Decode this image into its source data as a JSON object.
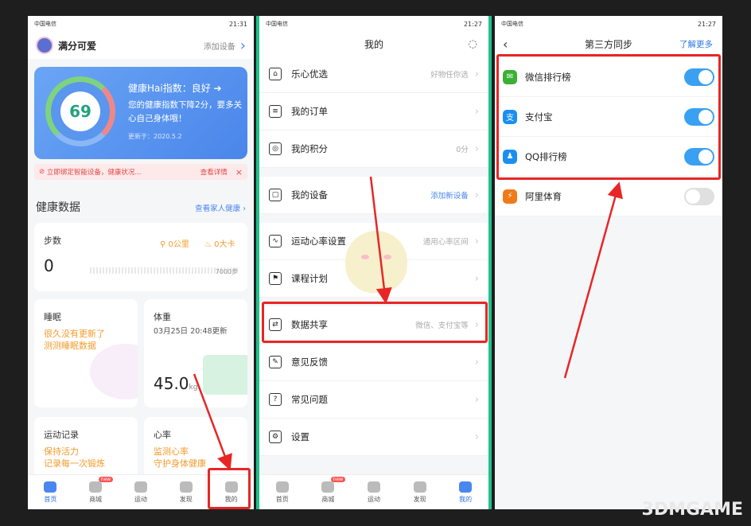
{
  "status": {
    "time1": "21:31",
    "time2": "21:27",
    "time3": "21:27",
    "carrier": "中国电信"
  },
  "p1": {
    "username": "满分可爱",
    "add_device": "添加设备",
    "health_title": "健康Hai指数：良好",
    "health_desc": "您的健康指数下降2分，要多关心自己身体哦！",
    "updated": "更新于：2020.5.2",
    "score": "69",
    "alert": "立即绑定智能设备，健康状况...",
    "alert_link": "查看详情",
    "section": "健康数据",
    "family": "查看家人健康",
    "steps_title": "步数",
    "steps_value": "0",
    "km": "0公里",
    "kcal": "0大卡",
    "target": "7000步",
    "sleep_title": "睡眠",
    "sleep_text1": "很久没有更新了",
    "sleep_text2": "测测睡眠数据",
    "weight_title": "体重",
    "weight_date": "03月25日 20:48更新",
    "weight_value": "45.0",
    "weight_unit": "kg",
    "sport_title": "运动记录",
    "sport_text1": "保持活力",
    "sport_text2": "记录每一次锻炼",
    "heart_title": "心率",
    "heart_text1": "监测心率",
    "heart_text2": "守护身体健康"
  },
  "tabs": [
    {
      "label": "首页"
    },
    {
      "label": "商城",
      "badge": "new"
    },
    {
      "label": "运动"
    },
    {
      "label": "发现"
    },
    {
      "label": "我的"
    }
  ],
  "p2": {
    "title": "我的",
    "items": [
      {
        "label": "乐心优选",
        "sub": "好物任你选"
      },
      {
        "label": "我的订单",
        "sub": ""
      },
      {
        "label": "我的积分",
        "sub": "0分"
      },
      {
        "label": "我的设备",
        "sub": "添加新设备"
      },
      {
        "label": "运动心率设置",
        "sub": "通用心率区间"
      },
      {
        "label": "课程计划",
        "sub": ""
      },
      {
        "label": "数据共享",
        "sub": "微信、支付宝等"
      },
      {
        "label": "意见反馈",
        "sub": ""
      },
      {
        "label": "常见问题",
        "sub": ""
      },
      {
        "label": "设置",
        "sub": ""
      }
    ]
  },
  "p3": {
    "title": "第三方同步",
    "more": "了解更多",
    "items": [
      {
        "label": "微信排行榜",
        "on": true,
        "color": "#3cb034"
      },
      {
        "label": "支付宝",
        "on": true,
        "color": "#1a8ff0"
      },
      {
        "label": "QQ排行榜",
        "on": true,
        "color": "#1a8ff0"
      },
      {
        "label": "阿里体育",
        "on": false,
        "color": "#f07a1a"
      }
    ]
  },
  "watermark": "3DMGAME"
}
